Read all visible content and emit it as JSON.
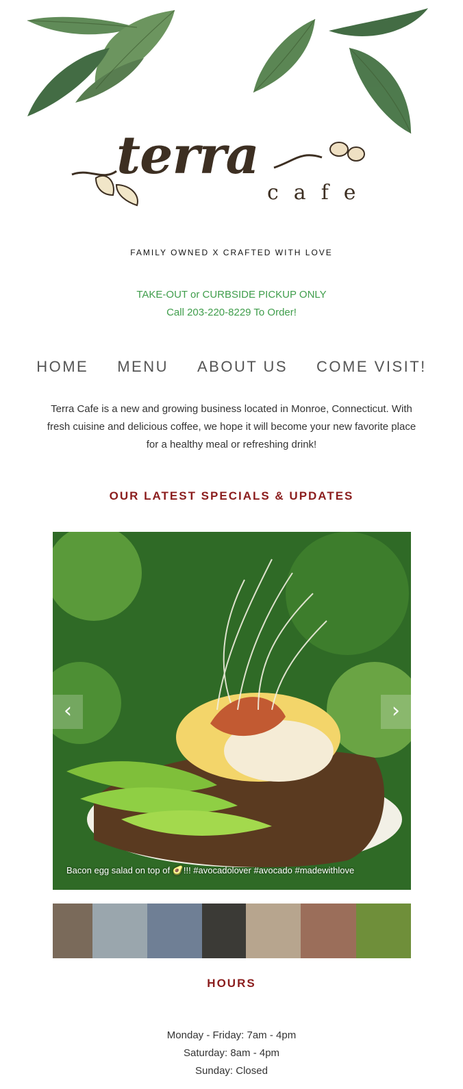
{
  "brand": {
    "name": "terra",
    "sub": "cafe"
  },
  "tagline": "FAMILY OWNED X CRAFTED WITH LOVE",
  "pickup": {
    "line1": "TAKE-OUT or CURBSIDE PICKUP ONLY",
    "line2": "Call 203-220-8229 To Order!"
  },
  "nav": {
    "items": [
      {
        "label": "HOME"
      },
      {
        "label": "MENU"
      },
      {
        "label": "ABOUT US"
      },
      {
        "label": "COME VISIT!"
      }
    ]
  },
  "intro": "Terra Cafe is a new and growing business located in Monroe, Connecticut. With fresh cuisine and delicious coffee, we hope it will become your new favorite place for a healthy meal or refreshing drink!",
  "specials": {
    "heading": "OUR LATEST SPECIALS & UPDATES",
    "caption": "Bacon egg salad on top of 🥑!!! #avocadolover #avocado #madewithlove",
    "prev_icon": "chevron-left-icon",
    "next_icon": "chevron-right-icon",
    "thumbnail_colors": [
      "#7a6a5a",
      "#9aa6ad",
      "#6f7f95",
      "#3b3a36",
      "#b7a58e",
      "#9b6e5a",
      "#6f8f3a"
    ]
  },
  "hours": {
    "heading": "HOURS",
    "lines": [
      "Monday - Friday: 7am - 4pm",
      "Saturday: 8am - 4pm",
      "Sunday: Closed"
    ]
  },
  "colors": {
    "accent_green": "#3f9d4b",
    "heading_red": "#8b1d1d",
    "brand_brown": "#3d2f22",
    "leaf_green": "#3e6f3a"
  }
}
